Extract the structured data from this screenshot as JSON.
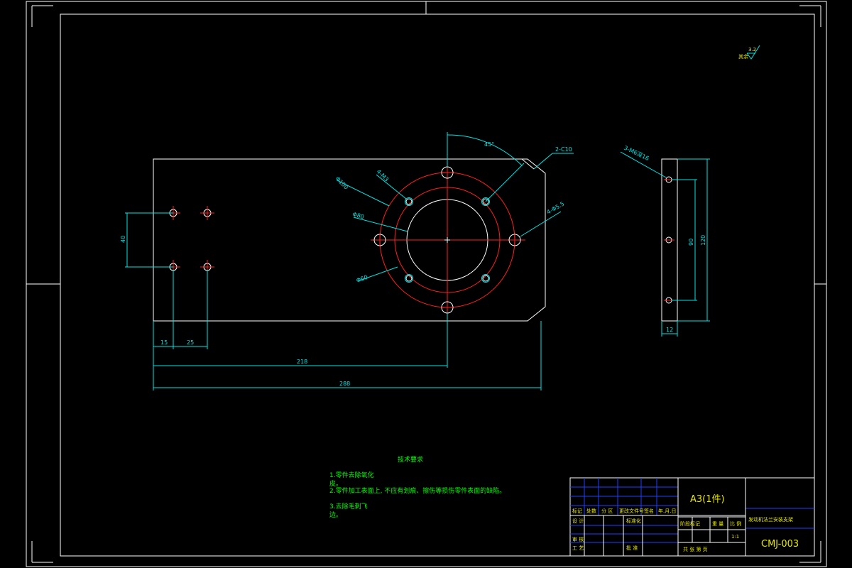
{
  "dimensions": {
    "d15": "15",
    "d25": "25",
    "d218": "218",
    "d288": "288",
    "d40": "40",
    "d90": "90",
    "d120": "120",
    "d12": "12",
    "angle45": "45°",
    "chamfer": "2-C10",
    "phi100": "Φ100",
    "holes4m3": "4-M3",
    "phi80": "Φ80",
    "phi60": "Φ60",
    "holes4phi55": "4-Φ5.5",
    "holes3m6": "3-M6深16"
  },
  "roughness": {
    "prefix": "其余",
    "value": "3.2"
  },
  "notes": {
    "title": "技术要求",
    "line1a": "1.零件去除氧化",
    "line1b": "皮。",
    "line2": "2.零件加工表面上, 不应有划痕、擦伤等损伤零件表面的缺陷。",
    "line3a": "3.去除毛刺飞",
    "line3b": "边。"
  },
  "title_block": {
    "material": "A3(1件)",
    "part_name": "发动机法兰安装支架",
    "drawing_no": "CMJ-003",
    "scale": "1:1",
    "row_labels": [
      "标记",
      "处数",
      "分 区",
      "更改文件号",
      "签名",
      "年.月.日"
    ],
    "design": "设 计",
    "standard": "标准化",
    "review": "审 核",
    "process": "工 艺",
    "approve": "批 准",
    "stage": "阶段标记",
    "weight": "重 量",
    "ratio": "比 例",
    "sheets": "共  张  第  页"
  },
  "colors": {
    "outline": "#ffffff",
    "dimension": "#00e5e5",
    "centerline": "#ff2020",
    "grid": "#2040ff",
    "notes": "#00ff00",
    "titletext": "#e8e800"
  }
}
